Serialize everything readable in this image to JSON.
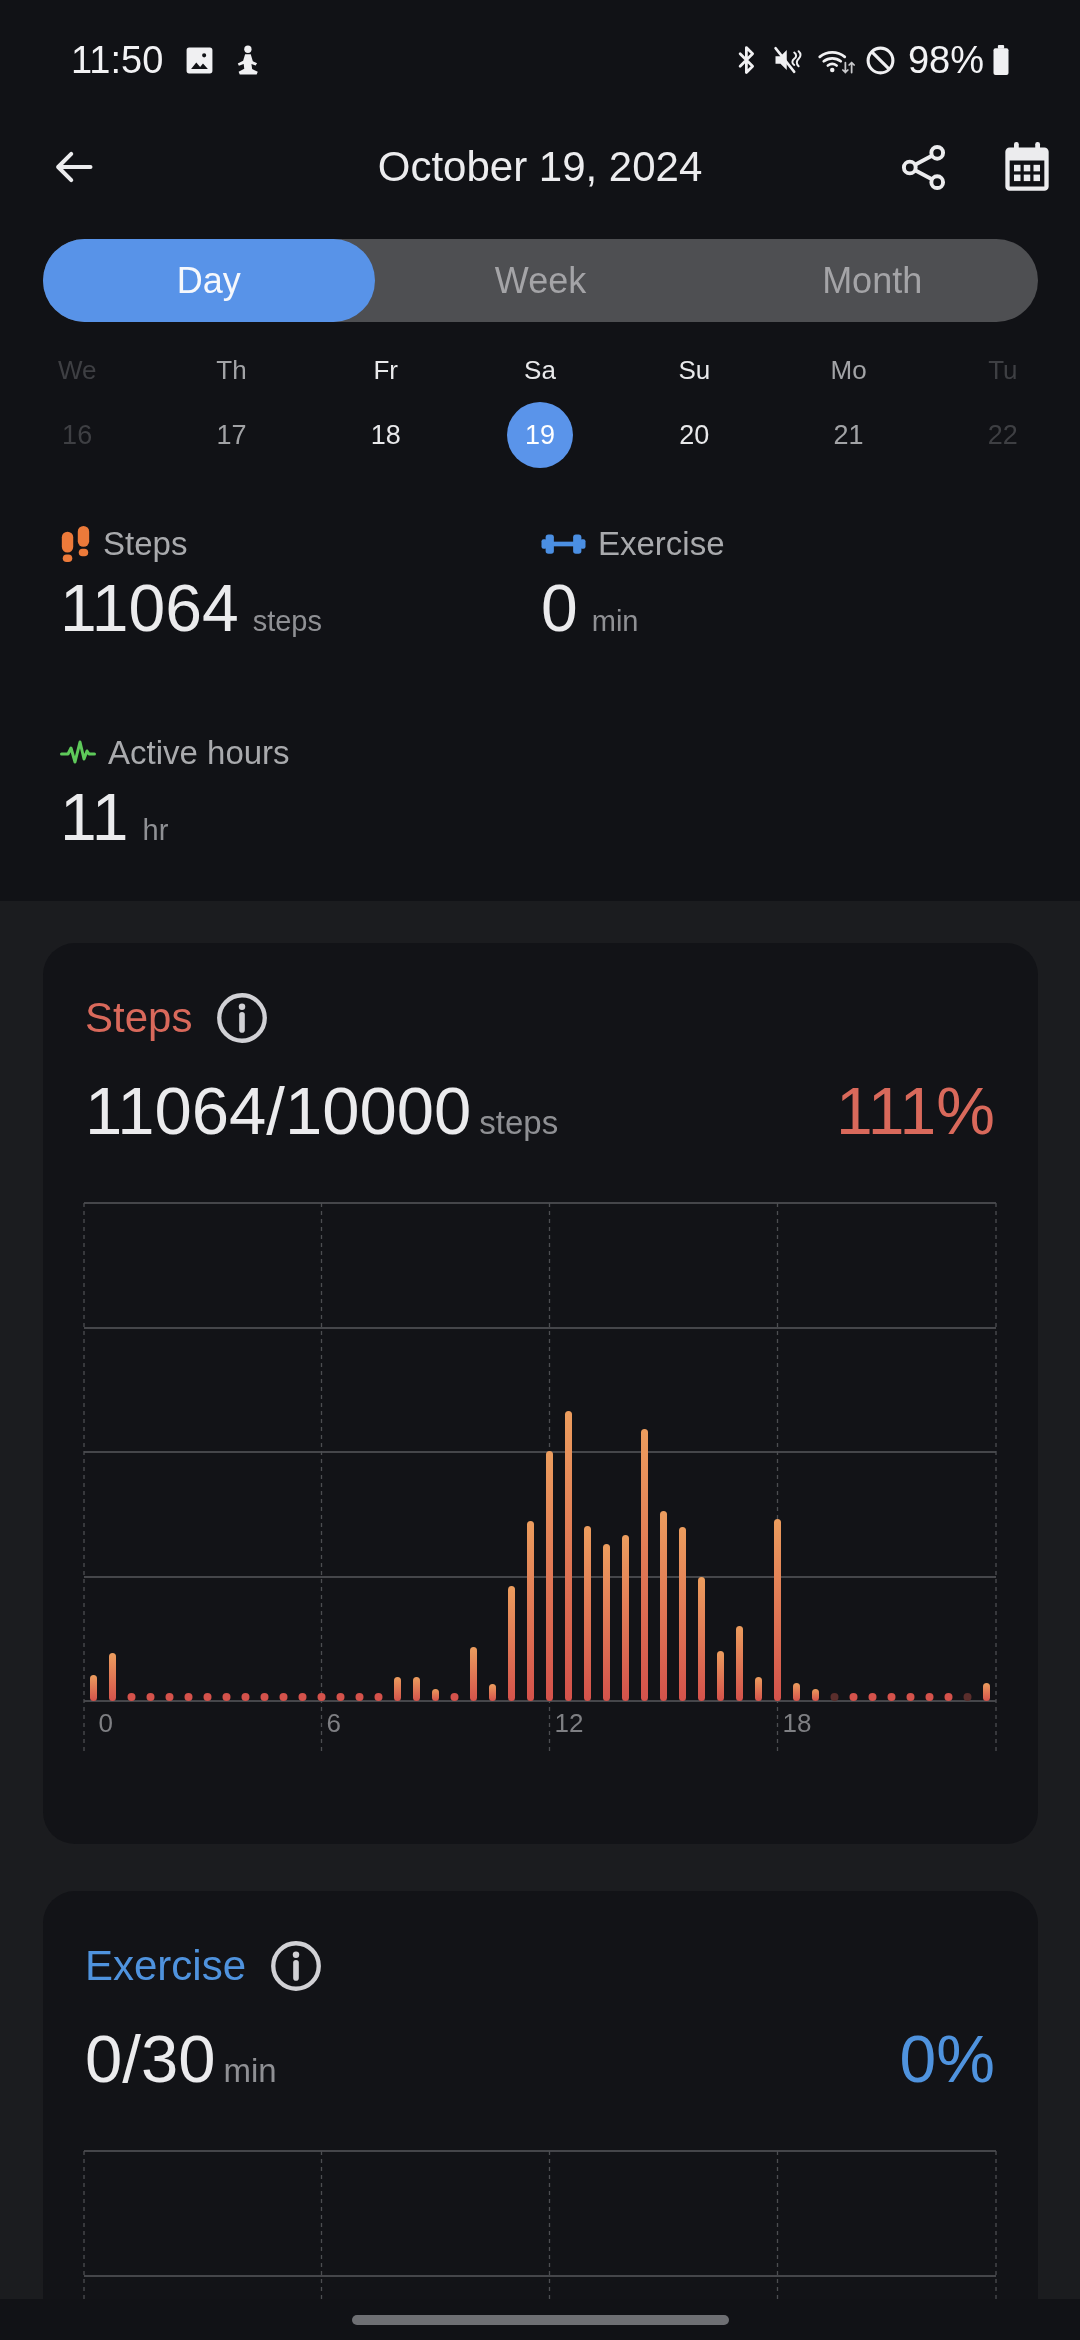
{
  "status_bar": {
    "time": "11:50",
    "battery": "98%"
  },
  "header": {
    "title": "October 19, 2024"
  },
  "tabs": [
    {
      "label": "Day",
      "selected": true
    },
    {
      "label": "Week",
      "selected": false
    },
    {
      "label": "Month",
      "selected": false
    }
  ],
  "days": [
    {
      "weekday": "We",
      "date": "16",
      "kind": "faint",
      "selected": false
    },
    {
      "weekday": "Th",
      "date": "17",
      "kind": "muted",
      "selected": false
    },
    {
      "weekday": "Fr",
      "date": "18",
      "kind": "bright",
      "selected": false
    },
    {
      "weekday": "Sa",
      "date": "19",
      "kind": "bright",
      "selected": true
    },
    {
      "weekday": "Su",
      "date": "20",
      "kind": "bright",
      "selected": false
    },
    {
      "weekday": "Mo",
      "date": "21",
      "kind": "muted",
      "selected": false
    },
    {
      "weekday": "Tu",
      "date": "22",
      "kind": "faint",
      "selected": false
    }
  ],
  "summary": [
    {
      "kind": "steps",
      "label": "Steps",
      "value": "11064",
      "unit": "steps"
    },
    {
      "kind": "exercise",
      "label": "Exercise",
      "value": "0",
      "unit": "min"
    },
    {
      "kind": "active_hours",
      "label": "Active hours",
      "value": "11",
      "unit": "hr"
    }
  ],
  "cards": [
    {
      "kind": "steps",
      "title": "Steps",
      "value": "11064/10000",
      "unit": "steps",
      "percent": "111%",
      "color": "#d9695b",
      "x_labels": [
        "0",
        "6",
        "12",
        "18"
      ]
    },
    {
      "kind": "exercise",
      "title": "Exercise",
      "value": "0/30",
      "unit": "min",
      "percent": "0%",
      "color": "#4f93de"
    }
  ]
}
